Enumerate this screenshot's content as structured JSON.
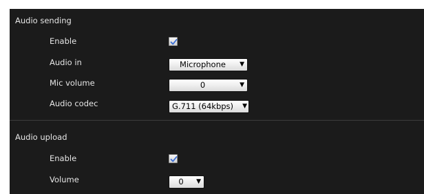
{
  "audio_sending": {
    "title": "Audio sending",
    "enable": {
      "label": "Enable",
      "checked": true
    },
    "audio_in": {
      "label": "Audio in",
      "value": "Microphone"
    },
    "mic_volume": {
      "label": "Mic volume",
      "value": "0"
    },
    "audio_codec": {
      "label": "Audio codec",
      "value": "G.711 (64kbps)"
    }
  },
  "audio_upload": {
    "title": "Audio upload",
    "enable": {
      "label": "Enable",
      "checked": true
    },
    "volume": {
      "label": "Volume",
      "value": "0"
    }
  },
  "icons": {
    "checkmark": "checkmark-icon",
    "dropdown": "triangle-down-icon"
  },
  "colors": {
    "panel_background": "#1b1b1b",
    "text": "#e6e6e6",
    "checkmark": "#3b6fd6"
  }
}
